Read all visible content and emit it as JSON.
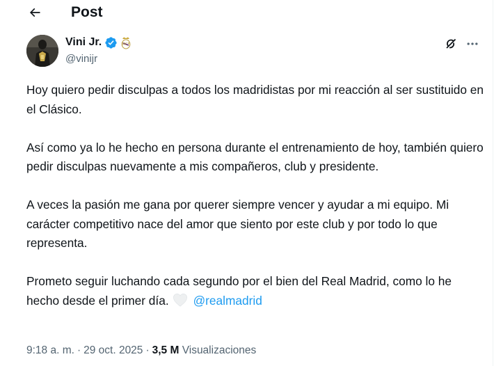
{
  "header": {
    "title": "Post"
  },
  "author": {
    "name": "Vini Jr.",
    "handle": "@vinijr",
    "verified_color": "#1d9bf0"
  },
  "tweet": {
    "paragraphs": [
      "Hoy quiero pedir disculpas a todos los madridistas por mi reacción al ser sustituido en el Clásico.",
      "Así como ya lo he hecho en persona durante el entrenamiento de hoy, también quiero pedir disculpas nuevamente a mis compañeros, club y presidente.",
      "A veces la pasión me gana por querer siempre vencer y ayudar a mi equipo. Mi carácter competitivo nace del amor que siento por este club y por todo lo que representa."
    ],
    "last_paragraph": "Prometo seguir luchando cada segundo por el bien del Real Madrid, como lo he hecho desde el primer día.",
    "mention": "@realmadrid"
  },
  "meta": {
    "time": "9:18 a. m.",
    "separator": "·",
    "date": "29 oct. 2025",
    "views_count": "3,5 M",
    "views_label": "Visualizaciones"
  },
  "icons": {
    "back": "back-arrow-icon",
    "verified": "verified-badge-icon",
    "club_badge": "real-madrid-badge-icon",
    "grok": "grok-icon",
    "more": "more-options-icon",
    "heart": "white-heart-emoji"
  }
}
